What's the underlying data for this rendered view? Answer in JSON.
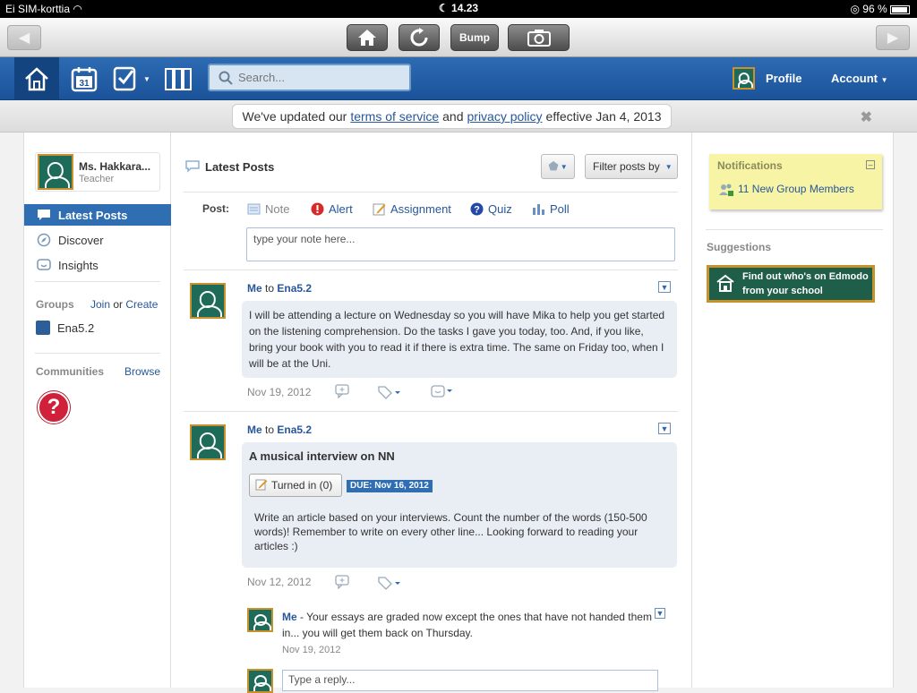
{
  "status_bar": {
    "carrier": "Ei SIM-korttia",
    "time": "14.23",
    "battery": "96 %"
  },
  "browser": {
    "bump_label": "Bump"
  },
  "header": {
    "calendar_day": "31",
    "search_placeholder": "Search...",
    "profile_label": "Profile",
    "account_label": "Account"
  },
  "banner": {
    "prefix": "We've updated our",
    "tos": "terms of service",
    "and": "and",
    "privacy": "privacy policy",
    "suffix": "effective Jan 4, 2013"
  },
  "sidebar": {
    "user_name": "Ms. Hakkara...",
    "user_role": "Teacher",
    "nav": [
      {
        "label": "Latest Posts"
      },
      {
        "label": "Discover"
      },
      {
        "label": "Insights"
      }
    ],
    "groups_title": "Groups",
    "join": "Join",
    "or": "or",
    "create": "Create",
    "group_name": "Ena5.2",
    "group_color": "#2d5f96",
    "communities_title": "Communities",
    "browse": "Browse"
  },
  "feed": {
    "title": "Latest Posts",
    "filter_label": "Filter posts by",
    "post_label": "Post:",
    "post_types": [
      {
        "label": "Note"
      },
      {
        "label": "Alert"
      },
      {
        "label": "Assignment"
      },
      {
        "label": "Quiz"
      },
      {
        "label": "Poll"
      }
    ],
    "note_placeholder": "type your note here...",
    "posts": [
      {
        "author": "Me",
        "to": "to",
        "group": "Ena5.2",
        "body": "I will be attending a lecture on Wednesday so you will have Mika to help you get started on the listening comprehension. Do the tasks I gave you today, too. And, if you like, bring your book with you to read it if there is extra time. The same on Friday too, when I will be at the Uni.",
        "date": "Nov 19, 2012"
      },
      {
        "author": "Me",
        "to": "to",
        "group": "Ena5.2",
        "title": "A musical interview on NN",
        "turned_in": "Turned in (0)",
        "due": "DUE: Nov 16, 2012",
        "body": "Write an article based on your interviews. Count the number of the words (150-500 words)! Remember to write on every other line... Looking forward to reading your articles :)",
        "date": "Nov 12, 2012"
      }
    ],
    "reply": {
      "author": "Me",
      "text": "- Your essays are graded now except the ones that have not handed them in... you will get them back on Thursday.",
      "date": "Nov 19, 2012"
    },
    "reply_placeholder": "Type a reply..."
  },
  "right": {
    "notifications_title": "Notifications",
    "notification_item": "11 New Group Members",
    "suggestions_title": "Suggestions",
    "find_line1": "Find out who's on Edmodo",
    "find_line2": "from your school"
  }
}
